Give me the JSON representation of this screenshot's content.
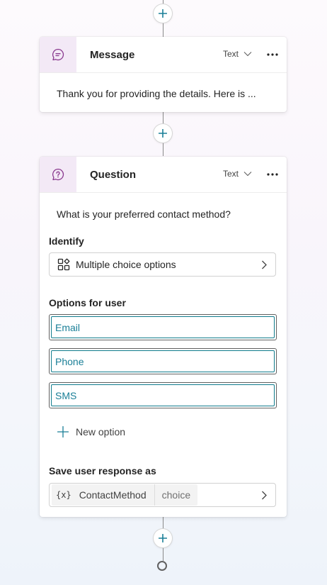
{
  "nodes": {
    "message": {
      "title": "Message",
      "type_select": "Text",
      "preview_text": "Thank you for providing the details. Here is ..."
    },
    "question": {
      "title": "Question",
      "type_select": "Text",
      "prompt": "What is your preferred contact method?",
      "identify": {
        "label": "Identify",
        "value": "Multiple choice options"
      },
      "options": {
        "label": "Options for user",
        "items": [
          "Email",
          "Phone",
          "SMS"
        ],
        "new_option_label": "New option"
      },
      "save_response": {
        "label": "Save user response as",
        "variable_icon": "{x}",
        "variable_name": "ContactMethod",
        "variable_type": "choice"
      }
    }
  },
  "icons": {
    "add": "plus-icon",
    "message": "chat-bubble-icon",
    "question": "question-bubble-icon",
    "more": "ellipsis-icon",
    "dropdown": "chevron-down-icon",
    "select": "chevron-right-icon",
    "choice": "multiple-choice-icon",
    "end": "end-node-icon"
  },
  "colors": {
    "accent": "#1a7f97",
    "icon_bg": "#f3e9f6",
    "icon_stroke": "#8a3a8f",
    "option_border": "#0f7b8c"
  }
}
